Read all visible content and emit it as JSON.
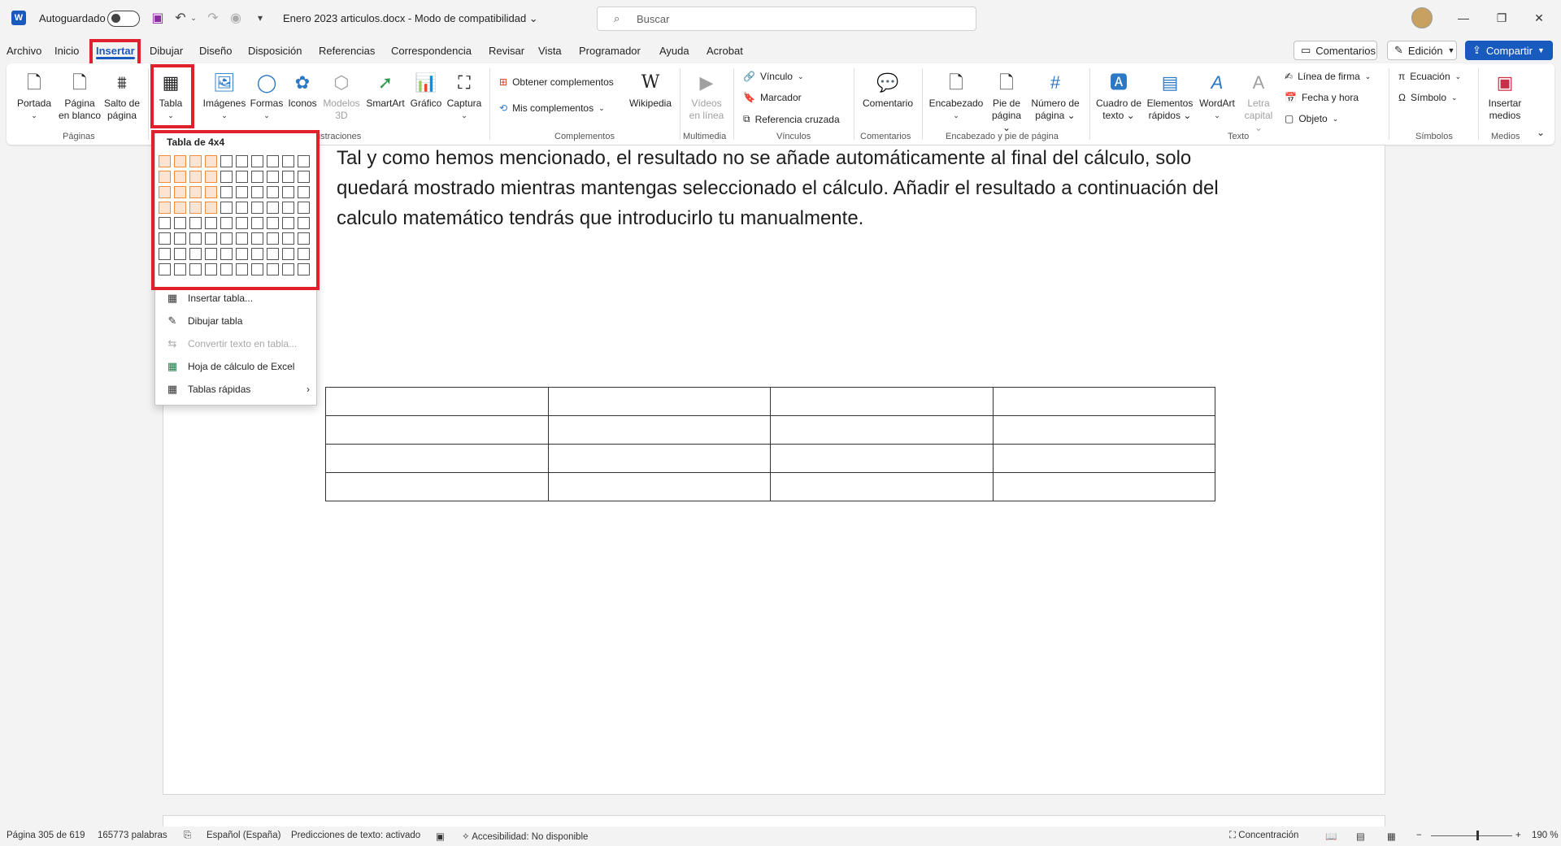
{
  "titlebar": {
    "autosave_label": "Autoguardado",
    "doc_title": "Enero 2023 articulos.docx  -  Modo de compatibilidad",
    "search_placeholder": "Buscar"
  },
  "tabs": [
    "Archivo",
    "Inicio",
    "Insertar",
    "Dibujar",
    "Diseño",
    "Disposición",
    "Referencias",
    "Correspondencia",
    "Revisar",
    "Vista",
    "Programador",
    "Ayuda",
    "Acrobat"
  ],
  "active_tab": "Insertar",
  "top_buttons": {
    "comments": "Comentarios",
    "edit": "Edición",
    "share": "Compartir"
  },
  "ribbon": {
    "paginas": {
      "portada": "Portada",
      "pagina_blanco_1": "Página",
      "pagina_blanco_2": "en blanco",
      "salto_1": "Salto de",
      "salto_2": "página",
      "label": "Páginas"
    },
    "tabla": "Tabla",
    "ilustraciones": {
      "imagenes": "Imágenes",
      "formas": "Formas",
      "iconos": "Iconos",
      "modelos_1": "Modelos",
      "modelos_2": "3D",
      "smartart": "SmartArt",
      "grafico": "Gráfico",
      "captura": "Captura",
      "label": "ustraciones"
    },
    "complementos": {
      "obtener": "Obtener complementos",
      "mis": "Mis complementos",
      "wikipedia": "Wikipedia",
      "label": "Complementos"
    },
    "multimedia": {
      "videos_1": "Vídeos",
      "videos_2": "en línea",
      "label": "Multimedia"
    },
    "vinculos": {
      "vinculo": "Vínculo",
      "marcador": "Marcador",
      "referencia": "Referencia cruzada",
      "label": "Vínculos"
    },
    "comentarios": {
      "comentario": "Comentario",
      "label": "Comentarios"
    },
    "encabezado": {
      "encabezado": "Encabezado",
      "pie_1": "Pie de",
      "pie_2": "página",
      "numero_1": "Número de",
      "numero_2": "página",
      "label": "Encabezado y pie de página"
    },
    "texto": {
      "cuadro_1": "Cuadro de",
      "cuadro_2": "texto",
      "elementos_1": "Elementos",
      "elementos_2": "rápidos",
      "wordart": "WordArt",
      "letra_1": "Letra",
      "letra_2": "capital",
      "linea_firma": "Línea de firma",
      "fecha": "Fecha y hora",
      "objeto": "Objeto",
      "label": "Texto"
    },
    "simbolos": {
      "ecuacion": "Ecuación",
      "simbolo": "Símbolo",
      "label": "Símbolos"
    },
    "medios": {
      "insertar_1": "Insertar",
      "insertar_2": "medios",
      "label": "Medios"
    }
  },
  "dropdown": {
    "title": "Tabla de 4x4",
    "selected_cols": 4,
    "selected_rows": 4,
    "items": [
      "Insertar tabla...",
      "Dibujar tabla",
      "Convertir texto en tabla...",
      "Hoja de cálculo de Excel",
      "Tablas rápidas"
    ]
  },
  "document": {
    "paragraph": "Tal y como hemos mencionado, el resultado no se añade automáticamente al final del cálculo, solo quedará mostrado mientras mantengas seleccionado el cálculo. Añadir el resultado a continuación del calculo matemático tendrás que introducirlo tu manualmente."
  },
  "status": {
    "page": "Página 305 de 619",
    "words": "165773 palabras",
    "language": "Español (España)",
    "predictions": "Predicciones de texto: activado",
    "accessibility": "Accesibilidad: No disponible",
    "focus": "Concentración",
    "zoom": "190 %"
  },
  "colors": {
    "accent": "#185abd",
    "highlight": "#e0202c",
    "grid_selected": "#f08c3c"
  }
}
